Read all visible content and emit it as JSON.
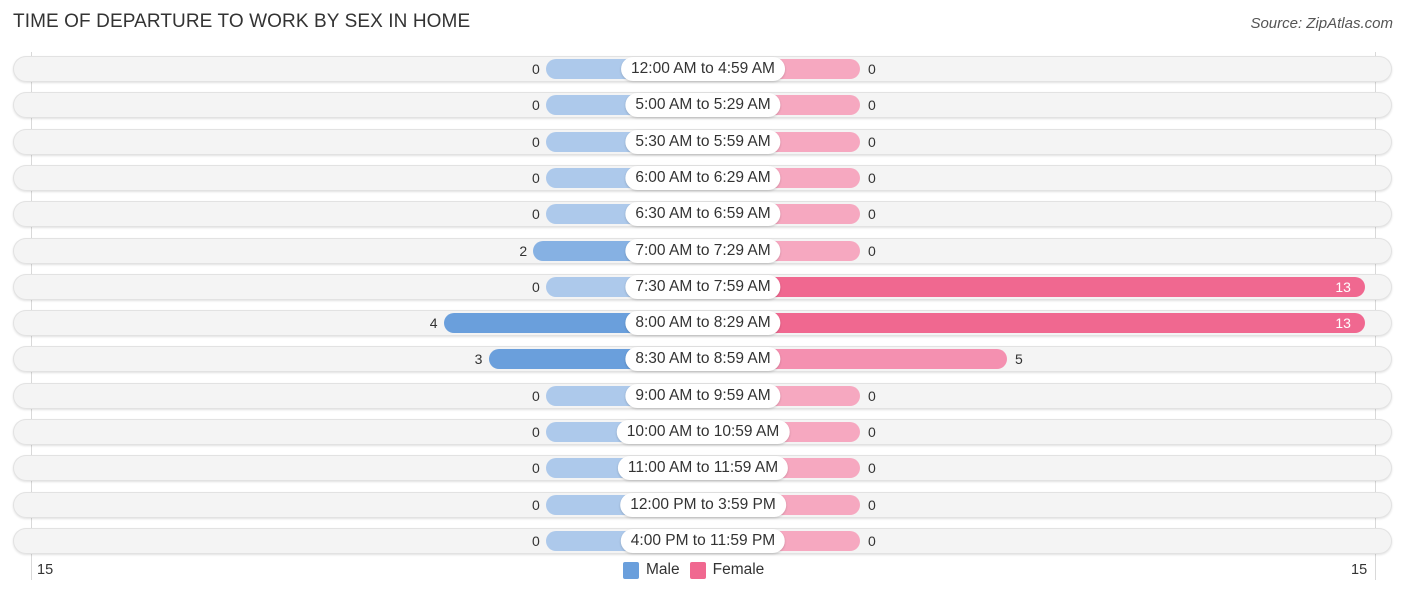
{
  "chart_data": {
    "type": "bar",
    "orientation": "horizontal-diverging",
    "title": "TIME OF DEPARTURE TO WORK BY SEX IN HOME",
    "source": "Source: ZipAtlas.com",
    "categories": [
      "12:00 AM to 4:59 AM",
      "5:00 AM to 5:29 AM",
      "5:30 AM to 5:59 AM",
      "6:00 AM to 6:29 AM",
      "6:30 AM to 6:59 AM",
      "7:00 AM to 7:29 AM",
      "7:30 AM to 7:59 AM",
      "8:00 AM to 8:29 AM",
      "8:30 AM to 8:59 AM",
      "9:00 AM to 9:59 AM",
      "10:00 AM to 10:59 AM",
      "11:00 AM to 11:59 AM",
      "12:00 PM to 3:59 PM",
      "4:00 PM to 11:59 PM"
    ],
    "series": [
      {
        "name": "Male",
        "color": "#6a9fdc",
        "values": [
          0,
          0,
          0,
          0,
          0,
          2,
          0,
          4,
          3,
          0,
          0,
          0,
          0,
          0
        ]
      },
      {
        "name": "Female",
        "color": "#f06890",
        "values": [
          0,
          0,
          0,
          0,
          0,
          0,
          13,
          13,
          5,
          0,
          0,
          0,
          0,
          0
        ]
      }
    ],
    "axis": {
      "min_label": "15",
      "max_label": "15",
      "xlim": [
        -15,
        15
      ]
    },
    "legend": {
      "position": "bottom-center",
      "items": [
        "Male",
        "Female"
      ]
    },
    "colors": {
      "male_full": "#6a9fdc",
      "male_light": "#adc9eb",
      "female_full": "#f06890",
      "female_light": "#f6a8c0"
    }
  }
}
